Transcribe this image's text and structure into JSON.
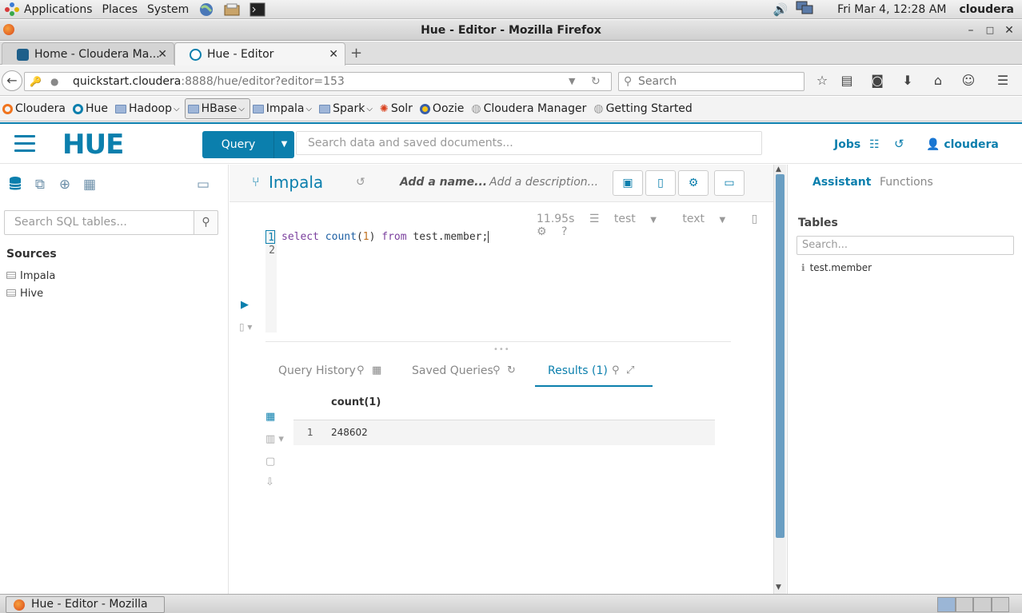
{
  "panel": {
    "applications": "Applications",
    "places": "Places",
    "system": "System",
    "clock": "Fri Mar  4, 12:28 AM",
    "user": "cloudera",
    "launchers": [
      "web-browser-icon",
      "file-manager-icon",
      "terminal-icon"
    ]
  },
  "window": {
    "title": "Hue - Editor - Mozilla Firefox"
  },
  "tabs": [
    {
      "label": "Home - Cloudera Ma...",
      "close": "✕",
      "active": false
    },
    {
      "label": "Hue - Editor",
      "close": "✕",
      "active": true
    }
  ],
  "new_tab": "+",
  "nav": {
    "url_host": "quickstart.cloudera",
    "url_path": ":8888/hue/editor?editor=153",
    "search_placeholder": "Search"
  },
  "bookmarks": [
    {
      "label": "Cloudera",
      "type": "link"
    },
    {
      "label": "Hue",
      "type": "link"
    },
    {
      "label": "Hadoop",
      "type": "folder"
    },
    {
      "label": "HBase",
      "type": "folder"
    },
    {
      "label": "Impala",
      "type": "folder"
    },
    {
      "label": "Spark",
      "type": "folder"
    },
    {
      "label": "Solr",
      "type": "link"
    },
    {
      "label": "Oozie",
      "type": "link"
    },
    {
      "label": "Cloudera Manager",
      "type": "link"
    },
    {
      "label": "Getting Started",
      "type": "link"
    }
  ],
  "hue": {
    "logo": "HUE",
    "query_button": "Query",
    "search_placeholder": "Search data and saved documents...",
    "jobs": "Jobs",
    "user": "cloudera",
    "accent": "#0b7fad"
  },
  "left": {
    "search_placeholder": "Search SQL tables...",
    "sources_title": "Sources",
    "sources": [
      "Impala",
      "Hive"
    ]
  },
  "editor": {
    "engine": "Impala",
    "name_placeholder": "Add a name...",
    "desc_placeholder": "Add a description...",
    "elapsed": "11.95s",
    "database": "test",
    "format": "text",
    "lines": [
      "1",
      "2"
    ],
    "code": {
      "kw1": "select",
      "fn": "count",
      "open": "(",
      "num": "1",
      "close": ")",
      "kw2": "from",
      "rest": "test.member;"
    }
  },
  "results": {
    "tabs": [
      "Query History",
      "Saved Queries",
      "Results (1)"
    ],
    "column": "count(1)",
    "rows": [
      {
        "index": "1",
        "value": "248602"
      }
    ]
  },
  "right": {
    "tab_assistant": "Assistant",
    "tab_functions": "Functions",
    "tables_title": "Tables",
    "search_placeholder": "Search...",
    "table": "test.member"
  },
  "taskbar": {
    "item": "Hue - Editor - Mozilla F..."
  }
}
